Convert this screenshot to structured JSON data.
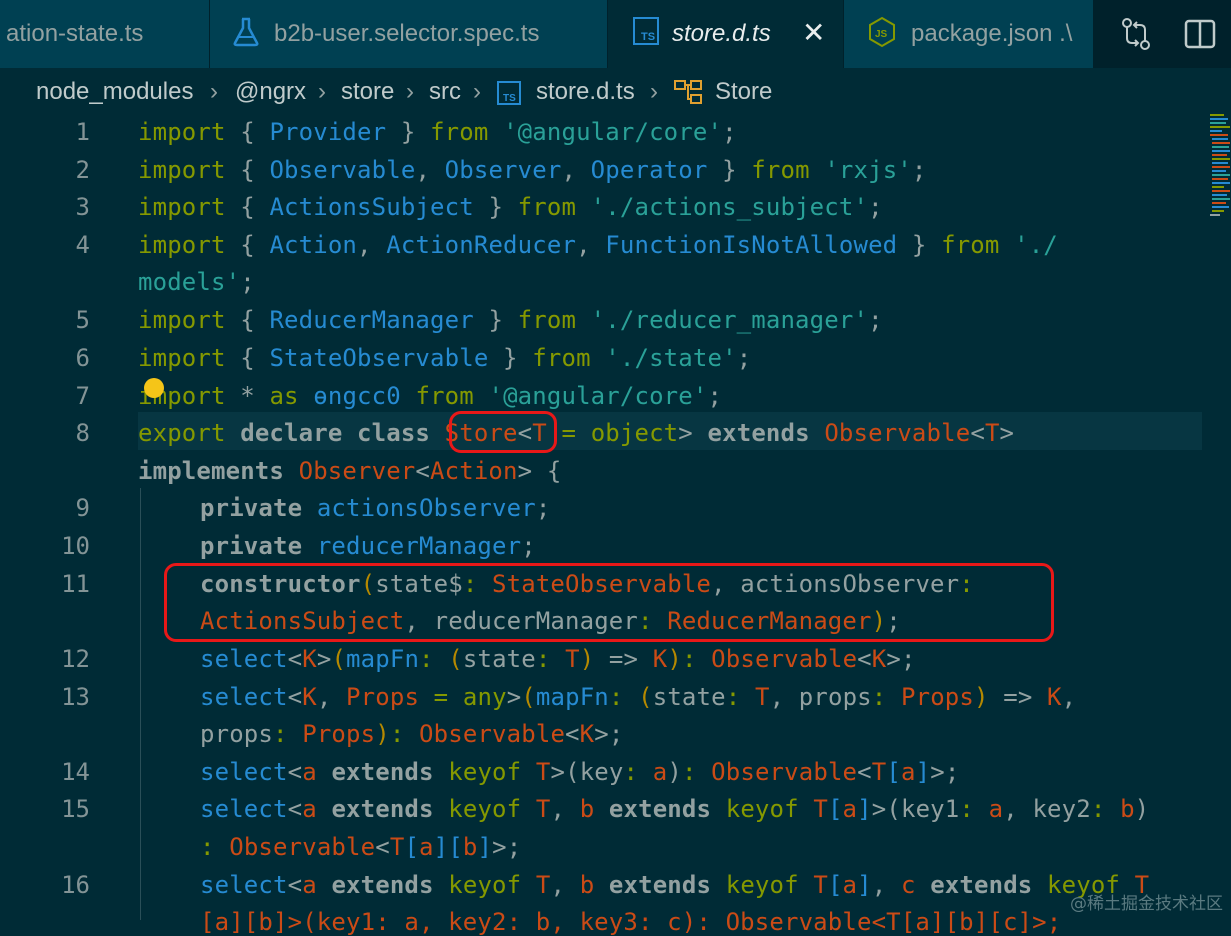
{
  "tabs": [
    {
      "label": "ation-state.ts",
      "icon": "typescript-file-icon",
      "active": false
    },
    {
      "label": "b2b-user.selector.spec.ts",
      "icon": "flask-icon",
      "active": false
    },
    {
      "label": "store.d.ts",
      "icon": "typescript-file-icon",
      "active": true
    },
    {
      "label": "package.json .\\",
      "icon": "nodejs-icon",
      "active": false
    }
  ],
  "breadcrumb": [
    "node_modules",
    "@ngrx",
    "store",
    "src",
    "store.d.ts",
    "Store"
  ],
  "line_numbers": [
    "1",
    "2",
    "3",
    "4",
    "5",
    "6",
    "7",
    "8",
    "9",
    "10",
    "11",
    "12",
    "13",
    "14",
    "15",
    "16"
  ],
  "code": {
    "l1": [
      "import",
      "{",
      "Provider",
      "}",
      "from",
      "'@angular/core'",
      ";"
    ],
    "l2": [
      "import",
      "{",
      "Observable",
      ",",
      "Observer",
      ",",
      "Operator",
      "}",
      "from",
      "'rxjs'",
      ";"
    ],
    "l3": [
      "import",
      "{",
      "ActionsSubject",
      "}",
      "from",
      "'./actions_subject'",
      ";"
    ],
    "l4": [
      "import",
      "{",
      "Action",
      ",",
      "ActionReducer",
      ",",
      "FunctionIsNotAllowed",
      "}",
      "from",
      "'./"
    ],
    "l4b": [
      "models'",
      ";"
    ],
    "l5": [
      "import",
      "{",
      "ReducerManager",
      "}",
      "from",
      "'./reducer_manager'",
      ";"
    ],
    "l6": [
      "import",
      "{",
      "StateObservable",
      "}",
      "from",
      "'./state'",
      ";"
    ],
    "l7": [
      "import",
      "*",
      "as",
      "ɵngcc0",
      "from",
      "'@angular/core'",
      ";"
    ],
    "l8": [
      "export",
      "declare",
      "class",
      "Store",
      "<",
      "T",
      "=",
      "object",
      ">",
      "extends",
      "Observable",
      "<",
      "T",
      ">"
    ],
    "l8b": [
      "implements",
      "Observer",
      "<",
      "Action",
      ">",
      "{"
    ],
    "l9": [
      "private",
      "actionsObserver",
      ";"
    ],
    "l10": [
      "private",
      "reducerManager",
      ";"
    ],
    "l11": [
      "constructor",
      "(",
      "state$",
      ":",
      "StateObservable",
      ",",
      "actionsObserver",
      ":"
    ],
    "l11b": [
      "ActionsSubject",
      ",",
      "reducerManager",
      ":",
      "ReducerManager",
      ")",
      ";"
    ],
    "l12": [
      "select",
      "<",
      "K",
      ">",
      "(",
      "mapFn",
      ":",
      "(",
      "state",
      ":",
      "T",
      ")",
      "=>",
      "K",
      ")",
      ":",
      "Observable",
      "<",
      "K",
      ">",
      ";"
    ],
    "l13": [
      "select",
      "<",
      "K",
      ",",
      "Props",
      "=",
      "any",
      ">",
      "(",
      "mapFn",
      ":",
      "(",
      "state",
      ":",
      "T",
      ",",
      "props",
      ":",
      "Props",
      ")",
      "=>",
      "K",
      ","
    ],
    "l13b": [
      "props",
      ":",
      "Props",
      ")",
      ":",
      "Observable",
      "<",
      "K",
      ">",
      ";"
    ],
    "l14": [
      "select",
      "<",
      "a",
      "extends",
      "keyof",
      "T",
      ">",
      "(",
      "key",
      ":",
      "a",
      ")",
      ":",
      "Observable",
      "<",
      "T",
      "[",
      "a",
      "]",
      ">",
      ";"
    ],
    "l15": [
      "select",
      "<",
      "a",
      "extends",
      "keyof",
      "T",
      ",",
      "b",
      "extends",
      "keyof",
      "T",
      "[",
      "a",
      "]",
      ">",
      "(",
      "key1",
      ":",
      "a",
      ",",
      "key2",
      ":",
      "b",
      ")"
    ],
    "l15b": [
      ":",
      "Observable",
      "<",
      "T",
      "[",
      "a",
      "]",
      "[",
      "b",
      "]",
      ">",
      ";"
    ],
    "l16": [
      "select",
      "<",
      "a",
      "extends",
      "keyof",
      "T",
      ",",
      "b",
      "extends",
      "keyof",
      "T",
      "[",
      "a",
      "]",
      ",",
      "c",
      "extends",
      "keyof",
      "T"
    ],
    "l16b": [
      "[a][b]>(key1: a, key2: b, key3: c): Observable<T[a][b][c]>;"
    ]
  },
  "watermark": "@稀土掘金技术社区",
  "colors": {
    "background": "#002b36",
    "highlight_box": "#e81818",
    "keyword": "#859900",
    "type": "#268bd2",
    "class": "#cb4b16",
    "string": "#2aa198"
  }
}
